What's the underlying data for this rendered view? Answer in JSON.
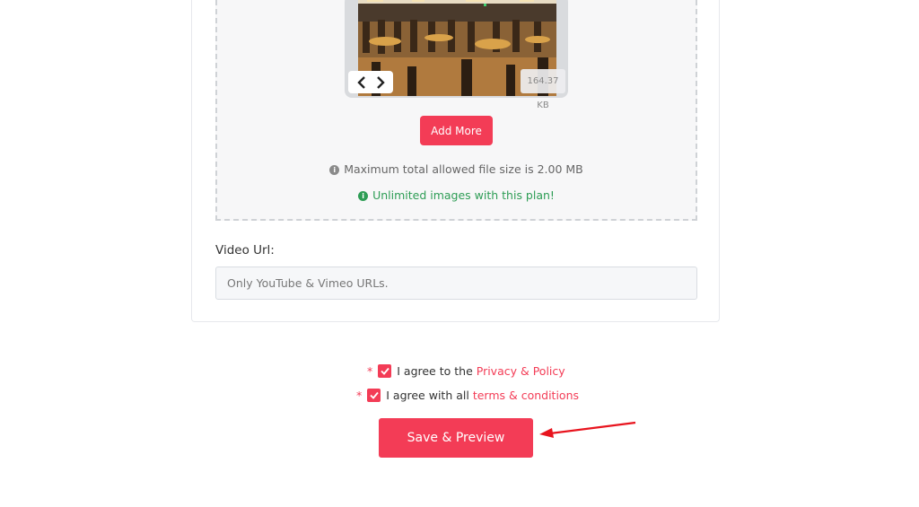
{
  "gallery": {
    "file_size": "164.37 KB",
    "add_more_label": "Add More",
    "max_size_text": "Maximum total allowed file size is 2.00 MB",
    "unlimited_text": "Unlimited images with this plan!",
    "prev_icon": "chevron-left-icon",
    "next_icon": "chevron-right-icon"
  },
  "video": {
    "label": "Video Url:",
    "placeholder": "Only YouTube & Vimeo URLs.",
    "value": ""
  },
  "agreements": {
    "required_marker": "*",
    "privacy_prefix": "I agree to the",
    "privacy_link": "Privacy & Policy",
    "terms_prefix": "I agree with all",
    "terms_link": "terms & conditions",
    "privacy_checked": true,
    "terms_checked": true
  },
  "submit": {
    "label": "Save & Preview"
  },
  "colors": {
    "accent": "#f33c56",
    "success": "#2e9d55",
    "annotation_arrow": "#e8141e"
  }
}
